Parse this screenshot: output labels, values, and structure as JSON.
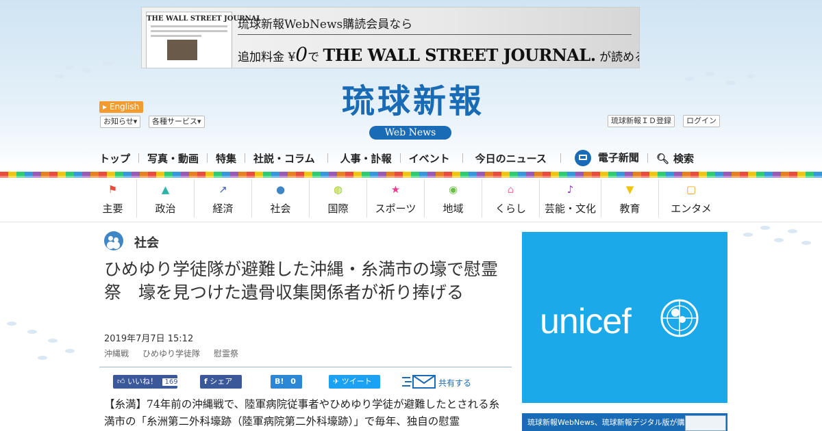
{
  "banner": {
    "paper_masthead": "THE WALL STREET JOURNAL",
    "line1": "琉球新報WebNews購読会員なら",
    "line2_prefix": "追加料金",
    "line2_yen": "¥",
    "line2_zero": "0",
    "line2_de": "で",
    "line2_wsj": "THE WALL STREET JOURNAL.",
    "line2_suffix": "が読める"
  },
  "header": {
    "english_label": "English",
    "notice_label": "お知らせ",
    "services_label": "各種サービス",
    "logo_text": "琉球新報",
    "webnews_label": "Web News",
    "id_register_label": "琉球新報ＩＤ登録",
    "login_label": "ログイン"
  },
  "main_nav": {
    "items": [
      "トップ",
      "写真・動画",
      "特集",
      "社説・コラム",
      "人事・訃報",
      "イベント",
      "今日のニュース"
    ],
    "digital_label": "電子新聞",
    "search_label": "検索"
  },
  "categories": [
    {
      "label": "主要",
      "icon": "flag-icon",
      "color": "#e74c3c"
    },
    {
      "label": "政治",
      "icon": "parliament-icon",
      "color": "#2fb3a8"
    },
    {
      "label": "経済",
      "icon": "trend-icon",
      "color": "#3a5fb0"
    },
    {
      "label": "社会",
      "icon": "people-icon",
      "color": "#3f86c7"
    },
    {
      "label": "国際",
      "icon": "globe-icon",
      "color": "#9bc53d"
    },
    {
      "label": "スポーツ",
      "icon": "runner-icon",
      "color": "#e83e8c"
    },
    {
      "label": "地域",
      "icon": "pin-icon",
      "color": "#6cc04a"
    },
    {
      "label": "くらし",
      "icon": "house-icon",
      "color": "#ef7ca2"
    },
    {
      "label": "芸能・文化",
      "icon": "music-icon",
      "color": "#8e44ad"
    },
    {
      "label": "教育",
      "icon": "grad-cap-icon",
      "color": "#f1c40f"
    },
    {
      "label": "エンタメ",
      "icon": "tv-icon",
      "color": "#f39c12"
    }
  ],
  "article": {
    "section": "社会",
    "title": "ひめゆり学徒隊が避難した沖縄・糸満市の壕で慰霊祭　壕を見つけた遺骨収集関係者が祈り捧げる",
    "date": "2019年7月7日 15:12",
    "tags": [
      "沖縄戦",
      "ひめゆり学徒隊",
      "慰霊祭"
    ],
    "body": "【糸満】74年前の沖縄戦で、陸軍病院従事者やひめゆり学徒が避難したとされる糸満市の「糸洲第二外科壕跡（陸軍病院第二外科壕跡）」で毎年、独自の慰霊"
  },
  "share": {
    "like_label": "いいね！",
    "like_count": "169",
    "fb_share_label": "シェア",
    "hatena_label": "B!",
    "hatena_count": "0",
    "tweet_label": "ツイート",
    "share_more_label": "共有する"
  },
  "sidebar": {
    "ad_brand": "unicef",
    "ad_color": "#1ca9e9",
    "promo_text": "琉球新報WebNews、琉球新報デジタル版が購読できる"
  },
  "colors": {
    "brand_blue": "#1a6bb5",
    "english_orange": "#f39b2f",
    "facebook": "#3b5998",
    "twitter": "#1da1f2"
  }
}
